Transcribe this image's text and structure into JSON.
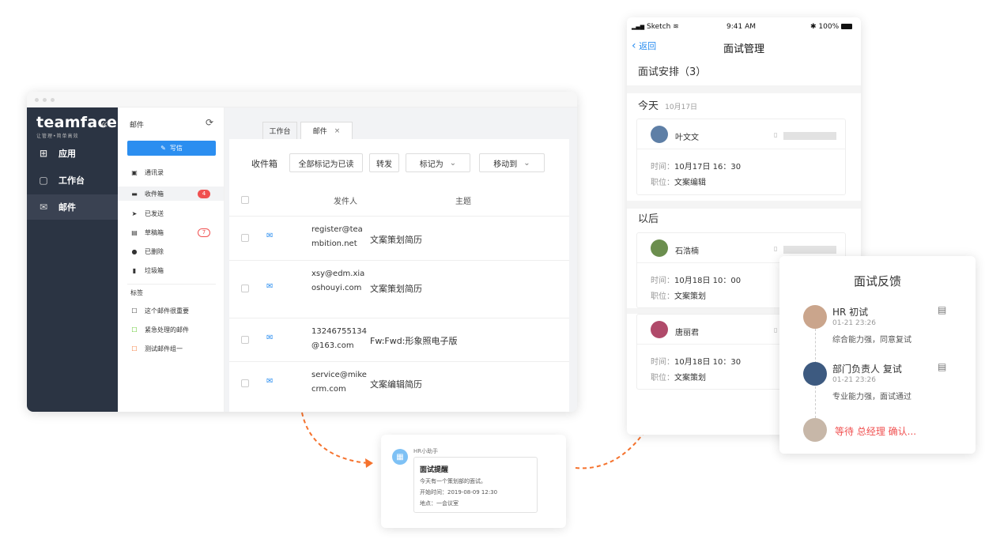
{
  "desktop": {
    "brand": {
      "logo": "teamface",
      "tagline": "让管理•简单高效",
      "collapse_glyph": "«"
    },
    "nav": [
      {
        "label": "应用",
        "icon": "apps-icon",
        "glyph": "⊞"
      },
      {
        "label": "工作台",
        "icon": "workbench-icon",
        "glyph": "▢"
      },
      {
        "label": "邮件",
        "icon": "mail-icon",
        "glyph": "✉"
      }
    ],
    "mail_sidebar": {
      "title": "邮件",
      "write_label": "写信",
      "contacts_label": "通讯录",
      "folders": [
        {
          "label": "收件箱",
          "badge": "4",
          "glyph": "▬"
        },
        {
          "label": "已发送",
          "badge": "",
          "glyph": "➤"
        },
        {
          "label": "草稿箱",
          "badge": "7",
          "glyph": "▤"
        },
        {
          "label": "已删除",
          "badge": "",
          "glyph": "●"
        },
        {
          "label": "垃圾箱",
          "badge": "",
          "glyph": "▮"
        }
      ],
      "tags_title": "标签",
      "tags": [
        {
          "label": "这个邮件很重要",
          "color": "#333333"
        },
        {
          "label": "紧急处理的邮件",
          "color": "#52c41a"
        },
        {
          "label": "测试邮件组一",
          "color": "#f5722d"
        }
      ]
    },
    "tabs": {
      "workbench": "工作台",
      "mail": "邮件",
      "close": "×"
    },
    "toolbar": {
      "folder": "收件箱",
      "mark_all_read": "全部标记为已读",
      "forward": "转发",
      "mark_as": "标记为",
      "move_to": "移动到"
    },
    "table": {
      "headers": {
        "sender": "发件人",
        "subject": "主题"
      },
      "rows": [
        {
          "sender": "register@teambition.net",
          "subject": "文案策划简历"
        },
        {
          "sender": "xsy@edm.xiaoshouyi.com",
          "subject": "文案策划简历"
        },
        {
          "sender": "13246755134@163.com",
          "subject": "Fw:Fwd:形象照电子版"
        },
        {
          "sender": "service@mikecrm.com",
          "subject": "文案编辑简历"
        }
      ]
    }
  },
  "notification": {
    "from": "HR小助手",
    "title": "面试提醒",
    "body": "今天有一个策划部的面试。",
    "start_time": "开始时间：2019-08-09 12:30",
    "location": "地点：一会议室"
  },
  "mobile": {
    "status": {
      "carrier": "Sketch",
      "time": "9:41 AM",
      "battery": "100%"
    },
    "back": "返回",
    "title": "面试管理",
    "section_title": "面试安排（3）",
    "today": {
      "label": "今天",
      "date": "10月17日"
    },
    "later_label": "以后",
    "time_label": "时间：",
    "position_label": "职位：",
    "cards": [
      {
        "name": "叶文文",
        "time": "10月17日 16：30",
        "position": "文案编辑"
      },
      {
        "name": "石浩楠",
        "time": "10月18日 10：00",
        "position": "文案策划"
      },
      {
        "name": "唐丽君",
        "time": "10月18日 10：30",
        "position": "文案策划"
      }
    ]
  },
  "feedback": {
    "title": "面试反馈",
    "entries": [
      {
        "name": "HR  初试",
        "time": "01-21 23:26",
        "note": "综合能力强，同意复试"
      },
      {
        "name": "部门负责人  复试",
        "time": "01-21 23:26",
        "note": "专业能力强，面试通过"
      }
    ],
    "pending": "等待 总经理 确认..."
  },
  "colors": {
    "accent": "#2b8ef0",
    "nav_bg": "#2b3443",
    "badge": "#f05050",
    "arrow": "#f5722d",
    "pending": "#f05050"
  }
}
